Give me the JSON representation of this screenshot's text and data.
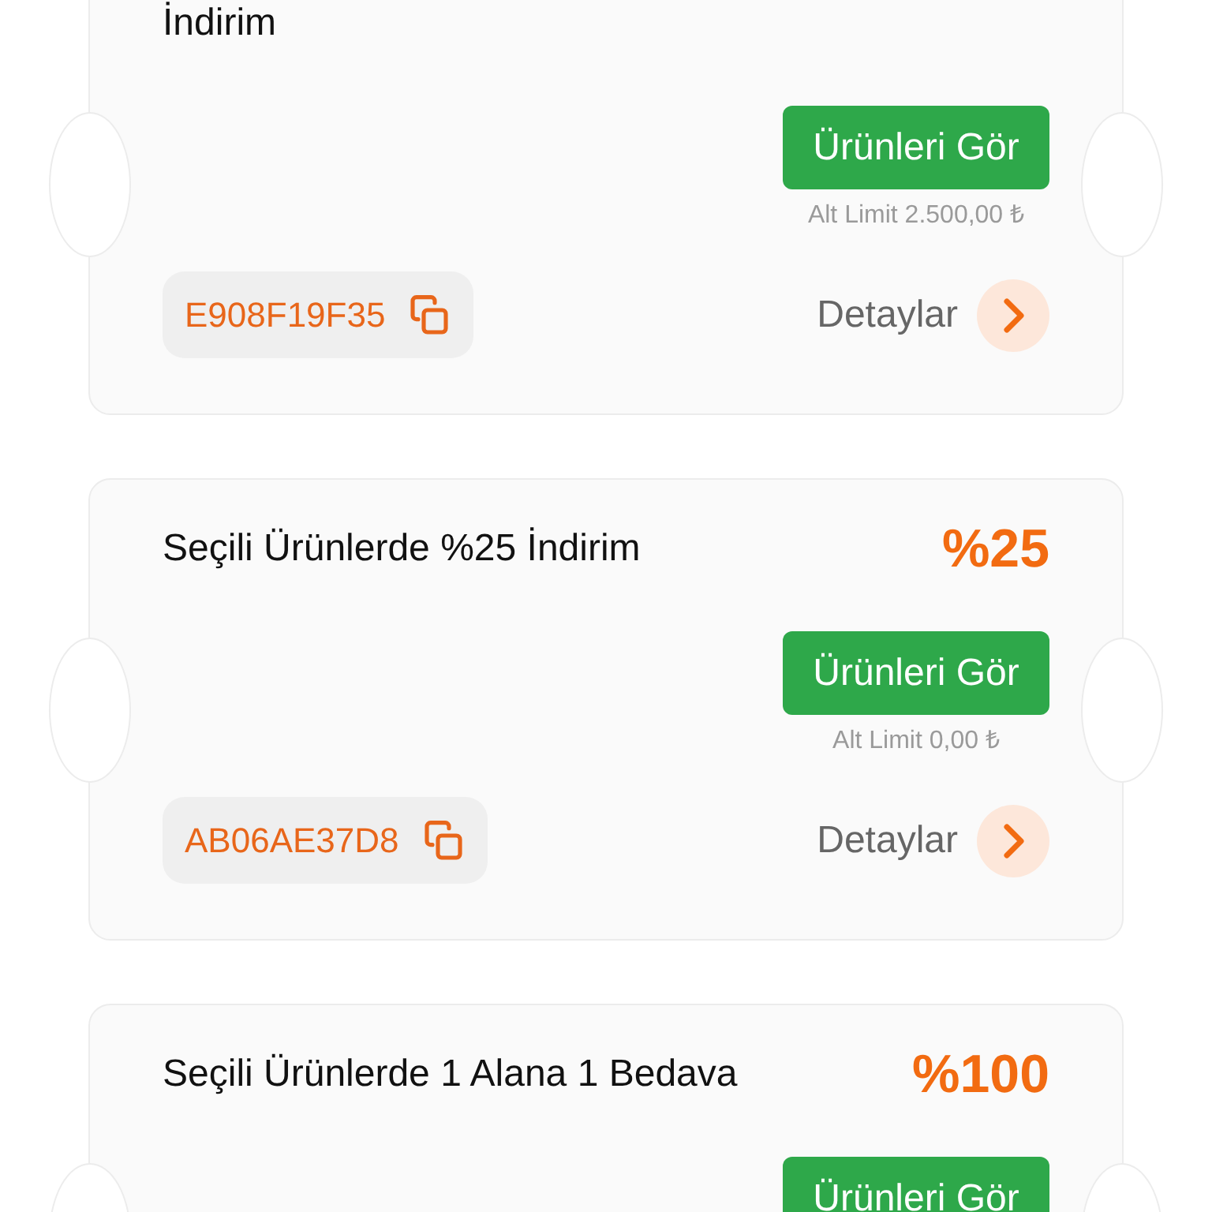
{
  "coupons": [
    {
      "title": "İndirim",
      "button": "Ürünleri Gör",
      "limit": "Alt Limit 2.500,00 ₺",
      "code": "E908F19F35",
      "details": "Detaylar"
    },
    {
      "title": "Seçili Ürünlerde %25 İndirim",
      "amount": "%25",
      "button": "Ürünleri Gör",
      "limit": "Alt Limit 0,00 ₺",
      "code": "AB06AE37D8",
      "details": "Detaylar"
    },
    {
      "title": "Seçili Ürünlerde 1 Alana 1 Bedava",
      "amount": "%100",
      "button": "Ürünleri Gör"
    }
  ]
}
